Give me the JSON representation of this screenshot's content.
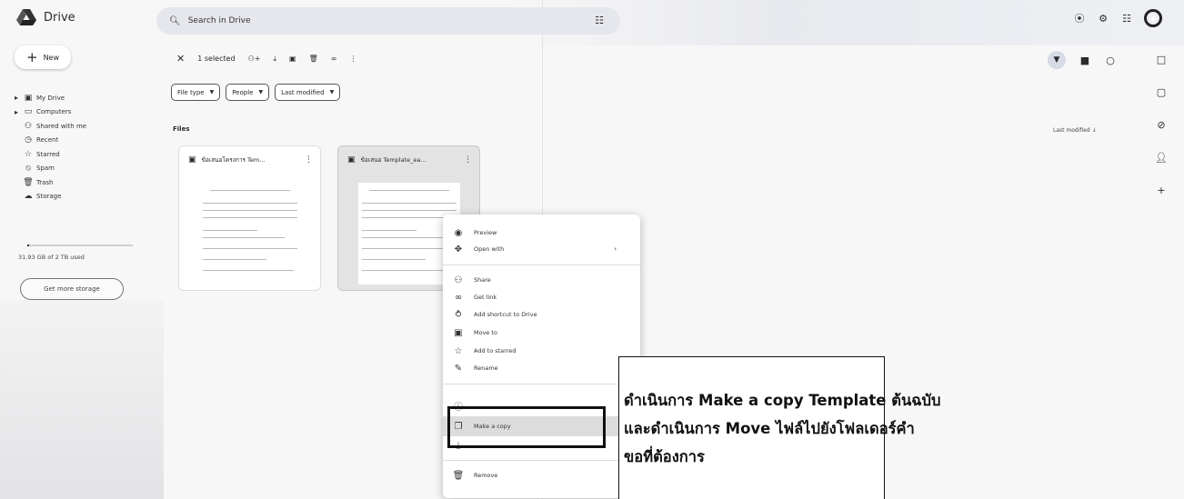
{
  "header": {
    "app_name": "Drive",
    "search_placeholder": "Search in Drive"
  },
  "sidebar": {
    "new_label": "New",
    "items": [
      {
        "label": "My Drive",
        "icon": "my-drive-icon"
      },
      {
        "label": "Computers",
        "icon": "computer-icon"
      },
      {
        "label": "Shared with me",
        "icon": "shared-icon"
      },
      {
        "label": "Recent",
        "icon": "clock-icon"
      },
      {
        "label": "Starred",
        "icon": "star-icon"
      },
      {
        "label": "Spam",
        "icon": "spam-icon"
      },
      {
        "label": "Trash",
        "icon": "trash-icon"
      },
      {
        "label": "Storage",
        "icon": "cloud-icon"
      }
    ],
    "storage_used": "31.93 GB of 2 TB used",
    "storage_fraction": 0.016,
    "get_storage_label": "Get more storage"
  },
  "toolbar": {
    "selected_label": "1 selected"
  },
  "filters": [
    "File type",
    "People",
    "Last modified"
  ],
  "files_section": {
    "title": "Files",
    "sort_label": "Last modified"
  },
  "files": [
    {
      "name": "ข้อเสนอโครงการ Tem..."
    },
    {
      "name": "ข้อเสนอ Template_ea..."
    }
  ],
  "context_menu": {
    "items": {
      "preview": "Preview",
      "open_with": "Open with",
      "share": "Share",
      "get_link": "Get link",
      "add_shortcut": "Add shortcut to Drive",
      "move_to": "Move to",
      "add_starred": "Add to starred",
      "rename": "Rename",
      "make_copy": "Make a copy",
      "remove": "Remove"
    },
    "highlighted": "Make a copy"
  },
  "annotation": {
    "line1": "ดำเนินการ Make a copy Template ต้นฉบับ",
    "line2": "และดำเนินการ Move ไฟล์ไปยังโฟลเดอร์คำ",
    "line3": "ขอที่ต้องการ"
  }
}
